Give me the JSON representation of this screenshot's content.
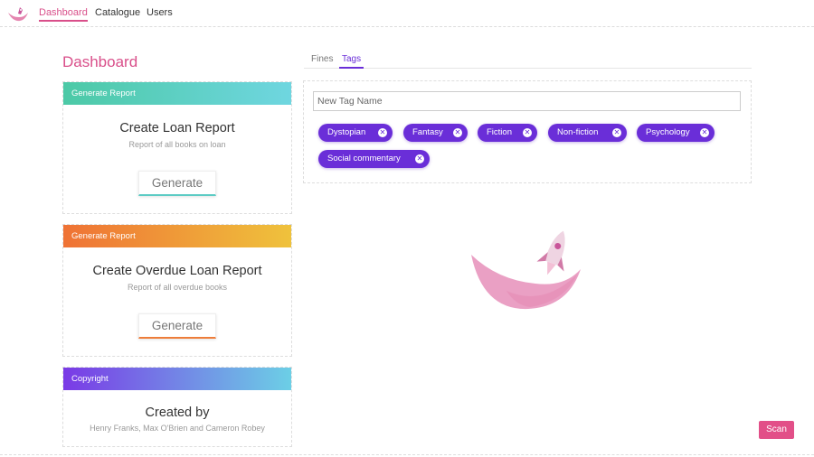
{
  "nav": {
    "logo_icon": "rocket-moon-logo-icon",
    "links": [
      {
        "label": "Dashboard",
        "active": true
      },
      {
        "label": "Catalogue",
        "active": false
      },
      {
        "label": "Users",
        "active": false
      }
    ]
  },
  "page": {
    "title": "Dashboard"
  },
  "cards": {
    "loan": {
      "header": "Generate Report",
      "title": "Create Loan Report",
      "subtitle": "Report of all books on loan",
      "button": "Generate"
    },
    "overdue": {
      "header": "Generate Report",
      "title": "Create Overdue Loan Report",
      "subtitle": "Report of all overdue books",
      "button": "Generate"
    },
    "copyright": {
      "header": "Copyright",
      "title": "Created by",
      "names": "Henry Franks, Max O'Brien and Cameron Robey"
    }
  },
  "tabs": [
    {
      "label": "Fines",
      "active": false
    },
    {
      "label": "Tags",
      "active": true
    }
  ],
  "tags_panel": {
    "input_placeholder": "New Tag Name",
    "tags": [
      "Dystopian",
      "Fantasy",
      "Fiction",
      "Non-fiction",
      "Psychology",
      "Social commentary"
    ]
  },
  "scan_button": "Scan",
  "colors": {
    "accent_pink": "#d94f8a",
    "tag_purple": "#6a2ed8",
    "scan_pink": "#e24f88"
  }
}
